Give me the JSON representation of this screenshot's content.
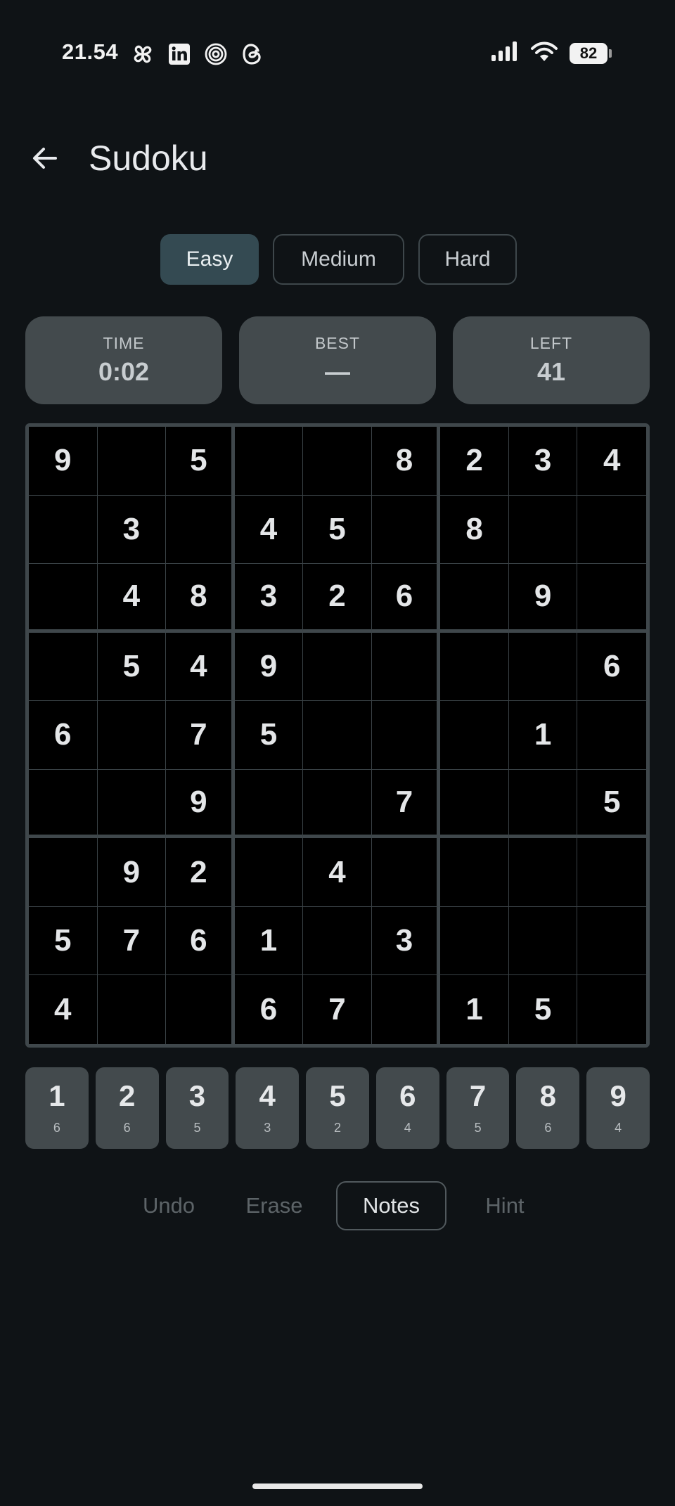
{
  "status_bar": {
    "time": "21.54",
    "left_icons": [
      "pinwheel-icon",
      "linkedin-icon",
      "target-icon",
      "threads-icon"
    ],
    "right_icons": [
      "signal-icon",
      "wifi-icon",
      "battery-icon"
    ],
    "battery_level": "82"
  },
  "header": {
    "back_icon": "arrow-left-icon",
    "title": "Sudoku"
  },
  "difficulty": {
    "selected": "Easy",
    "options": [
      "Easy",
      "Medium",
      "Hard"
    ]
  },
  "stats": [
    {
      "label": "TIME",
      "value": "0:02"
    },
    {
      "label": "BEST",
      "value": "—"
    },
    {
      "label": "LEFT",
      "value": "41"
    }
  ],
  "board": {
    "rows": [
      [
        "9",
        "",
        "5",
        "",
        "",
        "8",
        "2",
        "3",
        "4"
      ],
      [
        "",
        "3",
        "",
        "4",
        "5",
        "",
        "8",
        "",
        ""
      ],
      [
        "",
        "4",
        "8",
        "3",
        "2",
        "6",
        "",
        "9",
        ""
      ],
      [
        "",
        "5",
        "4",
        "9",
        "",
        "",
        "",
        "",
        "6"
      ],
      [
        "6",
        "",
        "7",
        "5",
        "",
        "",
        "",
        "1",
        ""
      ],
      [
        "",
        "",
        "9",
        "",
        "",
        "7",
        "",
        "",
        "5"
      ],
      [
        "",
        "9",
        "2",
        "",
        "4",
        "",
        "",
        "",
        ""
      ],
      [
        "5",
        "7",
        "6",
        "1",
        "",
        "3",
        "",
        "",
        ""
      ],
      [
        "4",
        "",
        "",
        "6",
        "7",
        "",
        "1",
        "5",
        ""
      ]
    ]
  },
  "numpad": [
    {
      "digit": "1",
      "count": "6"
    },
    {
      "digit": "2",
      "count": "6"
    },
    {
      "digit": "3",
      "count": "5"
    },
    {
      "digit": "4",
      "count": "3"
    },
    {
      "digit": "5",
      "count": "2"
    },
    {
      "digit": "6",
      "count": "4"
    },
    {
      "digit": "7",
      "count": "5"
    },
    {
      "digit": "8",
      "count": "6"
    },
    {
      "digit": "9",
      "count": "4"
    }
  ],
  "actions": {
    "undo": "Undo",
    "erase": "Erase",
    "notes": "Notes",
    "hint": "Hint"
  },
  "colors": {
    "background": "#0f1316",
    "selected_difficulty": "#344a52",
    "card": "#434a4d",
    "board_border": "#3f474b"
  }
}
